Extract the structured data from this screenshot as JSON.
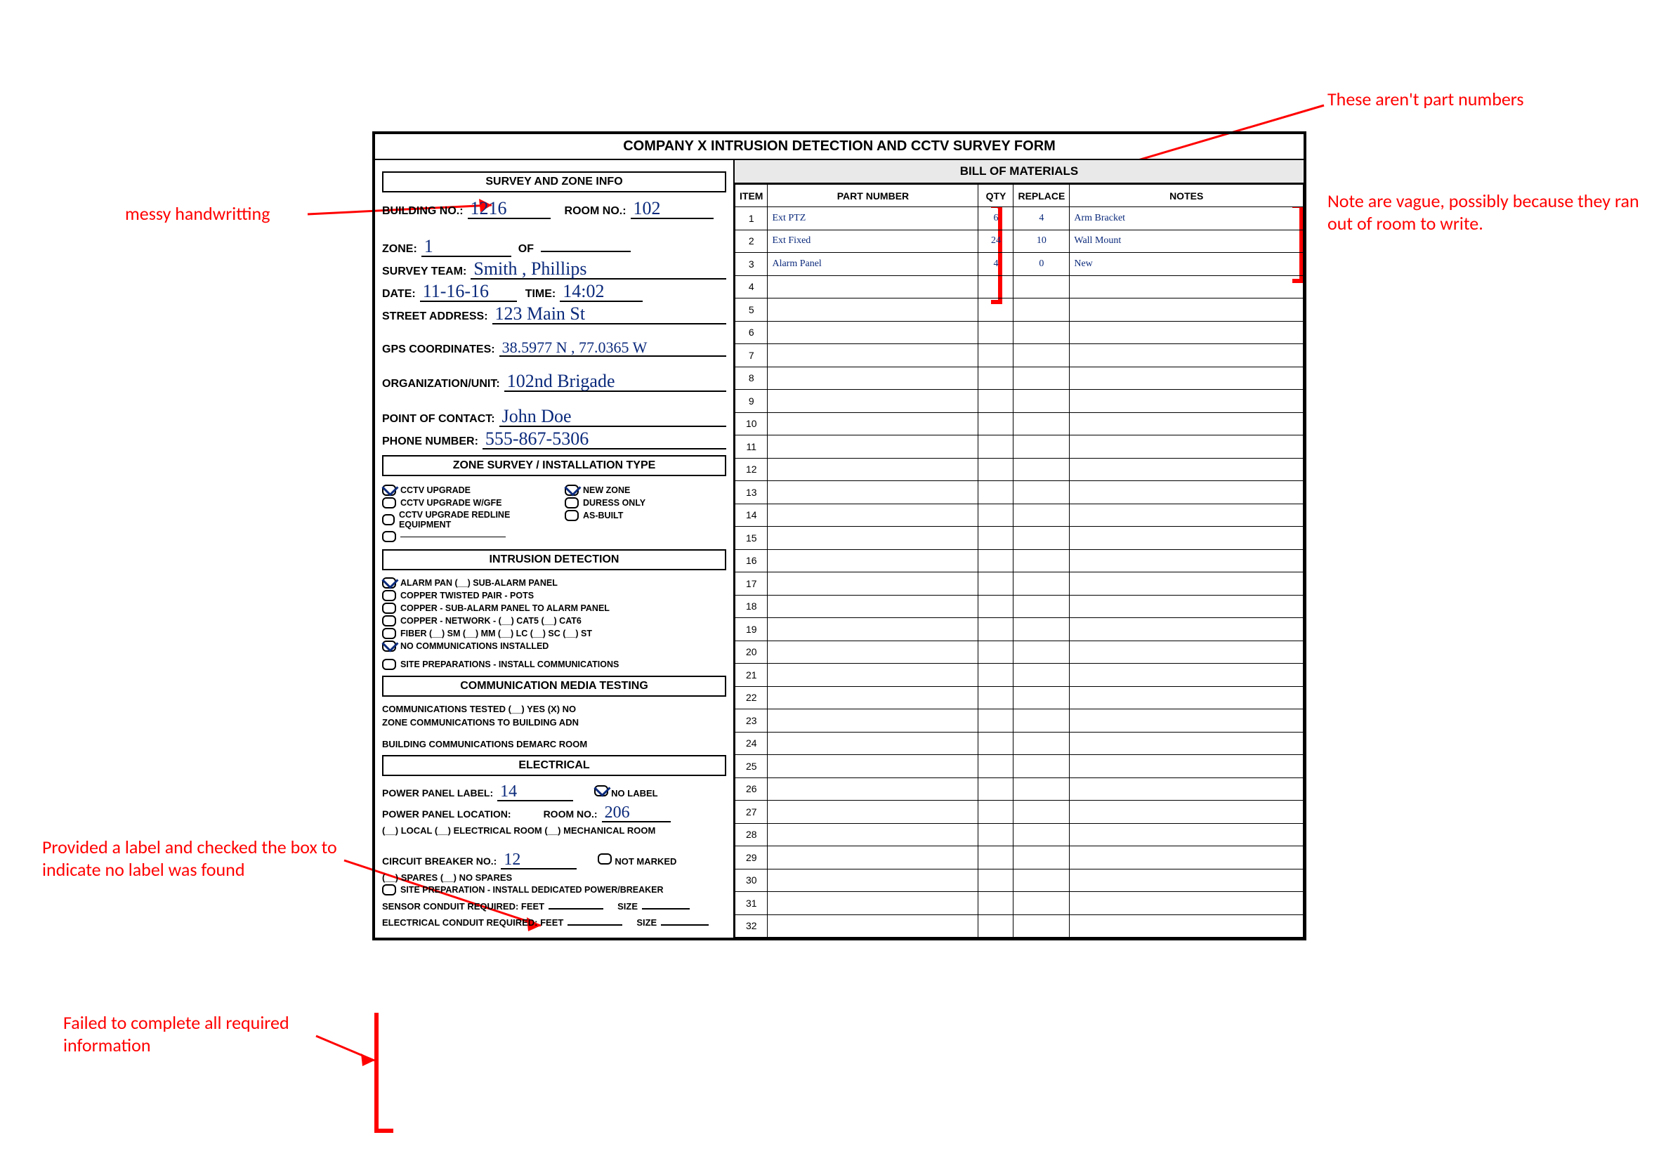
{
  "title": "COMPANY X INTRUSION DETECTION AND CCTV SURVEY FORM",
  "left": {
    "hdr_survey": "SURVEY AND ZONE INFO",
    "building_no_lab": "BUILDING NO.:",
    "building_no": "1216",
    "room_no_lab": "ROOM NO.:",
    "room_no": "102",
    "zone_lab": "ZONE:",
    "zone": "1",
    "of_lab": "OF",
    "of": "",
    "team_lab": "SURVEY TEAM:",
    "team": "Smith , Phillips",
    "date_lab": "DATE:",
    "date": "11-16-16",
    "time_lab": "TIME:",
    "time": "14:02",
    "addr_lab": "STREET ADDRESS:",
    "addr": "123 Main St",
    "gps_lab": "GPS COORDINATES:",
    "gps": "38.5977 N , 77.0365 W",
    "org_lab": "ORGANIZATION/UNIT:",
    "org": "102nd Brigade",
    "poc_lab": "POINT OF CONTACT:",
    "poc": "John Doe",
    "phone_lab": "PHONE NUMBER:",
    "phone": "555-867-5306",
    "hdr_zone": "ZONE SURVEY / INSTALLATION TYPE",
    "zs": {
      "cctv_up": "CCTV UPGRADE",
      "cctv_gfe": "CCTV UPGRADE W/GFE",
      "cctv_red": "CCTV UPGRADE REDLINE EQUIPMENT",
      "newzone": "NEW ZONE",
      "duress": "DURESS ONLY",
      "asbuilt": "AS-BUILT"
    },
    "hdr_intr": "INTRUSION DETECTION",
    "intr": {
      "alarm": "ALARM PAN (__)   SUB-ALARM PANEL",
      "pots": "COPPER TWISTED PAIR - POTS",
      "sub": "COPPER - SUB-ALARM PANEL TO ALARM PANEL",
      "net": "COPPER - NETWORK -  (__) CAT5   (__) CAT6",
      "fiber": "FIBER   (__) SM   (__) MM   (__) LC   (__) SC   (__) ST",
      "nocom": "NO COMMUNICATIONS INSTALLED",
      "site": "SITE PREPARATIONS - INSTALL COMMUNICATIONS"
    },
    "hdr_comm": "COMMUNICATION MEDIA TESTING",
    "comm": {
      "tested": "COMMUNICATIONS TESTED   (__) YES   (X) NO",
      "zone": "ZONE COMMUNICATIONS TO BUILDING ADN",
      "demarc": "BUILDING COMMUNICATIONS DEMARC ROOM"
    },
    "hdr_elec": "ELECTRICAL",
    "elec": {
      "panel_lab": "POWER PANEL LABEL:",
      "panel": "14",
      "nolabel": "NO LABEL",
      "loc_lab": "POWER PANEL LOCATION:",
      "loc_room_lab": "ROOM NO.:",
      "loc_room": "206",
      "loc_opts": "(__) LOCAL   (__) ELECTRICAL ROOM   (__) MECHANICAL ROOM",
      "cb_lab": "CIRCUIT BREAKER NO.:",
      "cb": "12",
      "notmarked": "NOT MARKED",
      "spares": "(__) SPARES   (__) NO SPARES",
      "siteprep": "SITE PREPARATION - INSTALL DEDICATED POWER/BREAKER",
      "sensor_lab": "SENSOR CONDUIT REQUIRED:  FEET",
      "size_lab": "SIZE",
      "econd_lab": "ELECTRICAL CONDUIT REQUIRED:  FEET"
    }
  },
  "right": {
    "hdr": "BILL OF MATERIALS",
    "cols": {
      "item": "ITEM",
      "part": "PART NUMBER",
      "qty": "QTY",
      "rep": "REPLACE",
      "notes": "NOTES"
    },
    "rows": [
      {
        "n": "1",
        "part": "Ext PTZ",
        "qty": "6",
        "rep": "4",
        "notes": "Arm Bracket"
      },
      {
        "n": "2",
        "part": "Ext Fixed",
        "qty": "24",
        "rep": "10",
        "notes": "Wall Mount"
      },
      {
        "n": "3",
        "part": "Alarm Panel",
        "qty": "4",
        "rep": "0",
        "notes": "New"
      },
      {
        "n": "4"
      },
      {
        "n": "5"
      },
      {
        "n": "6"
      },
      {
        "n": "7"
      },
      {
        "n": "8"
      },
      {
        "n": "9"
      },
      {
        "n": "10"
      },
      {
        "n": "11"
      },
      {
        "n": "12"
      },
      {
        "n": "13"
      },
      {
        "n": "14"
      },
      {
        "n": "15"
      },
      {
        "n": "16"
      },
      {
        "n": "17"
      },
      {
        "n": "18"
      },
      {
        "n": "19"
      },
      {
        "n": "20"
      },
      {
        "n": "21"
      },
      {
        "n": "22"
      },
      {
        "n": "23"
      },
      {
        "n": "24"
      },
      {
        "n": "25"
      },
      {
        "n": "26"
      },
      {
        "n": "27"
      },
      {
        "n": "28"
      },
      {
        "n": "29"
      },
      {
        "n": "30"
      },
      {
        "n": "31"
      },
      {
        "n": "32"
      }
    ]
  },
  "ann": {
    "a1": "These aren't part numbers",
    "a2": "Note are vague, possibly because they ran out of room to write.",
    "a3": "messy handwritting",
    "a4": "Provided a label and checked the box to indicate no label was found",
    "a5": "Failed to complete all required information"
  }
}
